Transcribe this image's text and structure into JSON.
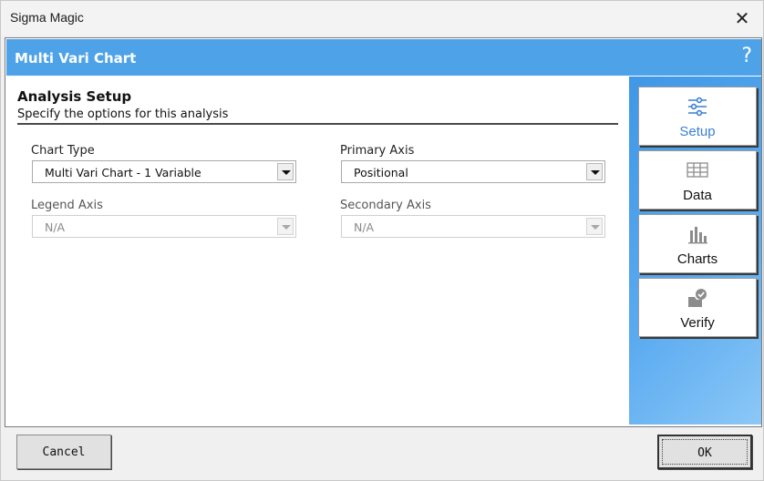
{
  "window": {
    "title": "Sigma Magic",
    "close_glyph": "✕"
  },
  "header": {
    "title": "Multi Vari Chart",
    "help_glyph": "?"
  },
  "section": {
    "title": "Analysis Setup",
    "subtitle": "Specify the options for this analysis"
  },
  "fields": {
    "chart_type": {
      "label": "Chart Type",
      "value": "Multi Vari Chart - 1 Variable",
      "enabled": true
    },
    "primary_axis": {
      "label": "Primary Axis",
      "value": "Positional",
      "enabled": true
    },
    "legend_axis": {
      "label": "Legend Axis",
      "value": "N/A",
      "enabled": false
    },
    "secondary_axis": {
      "label": "Secondary Axis",
      "value": "N/A",
      "enabled": false
    }
  },
  "nav": {
    "items": [
      {
        "label": "Setup",
        "icon": "sliders-icon",
        "active": true
      },
      {
        "label": "Data",
        "icon": "table-icon",
        "active": false
      },
      {
        "label": "Charts",
        "icon": "bar-chart-icon",
        "active": false
      },
      {
        "label": "Verify",
        "icon": "verify-icon",
        "active": false
      }
    ]
  },
  "footer": {
    "cancel_label": "Cancel",
    "ok_label": "OK"
  },
  "colors": {
    "header_bg": "#4ea2e8",
    "active_nav_text": "#3a7fd4",
    "sidebar_bg": "#5aaaf0"
  }
}
